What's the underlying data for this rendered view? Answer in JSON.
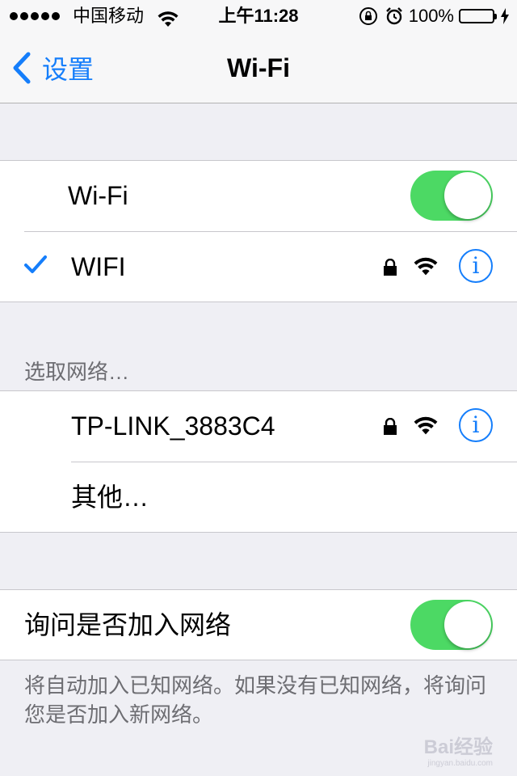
{
  "status_bar": {
    "carrier": "中国移动",
    "time": "上午11:28",
    "battery_pct": "100%",
    "battery_level": 1.0
  },
  "nav": {
    "back_label": "设置",
    "title": "Wi-Fi"
  },
  "wifi_toggle": {
    "label": "Wi-Fi",
    "on": true
  },
  "connected_network": {
    "name": "WIFI",
    "secured": true,
    "info_glyph": "i"
  },
  "choose_network_header": "选取网络…",
  "networks": [
    {
      "name": "TP-LINK_3883C4",
      "secured": true,
      "info_glyph": "i"
    }
  ],
  "other_label": "其他…",
  "ask_to_join": {
    "label": "询问是否加入网络",
    "on": true
  },
  "footer": "将自动加入已知网络。如果没有已知网络，将询问您是否加入新网络。",
  "watermark": {
    "brand": "Bai经验",
    "url": "jingyan.baidu.com"
  },
  "colors": {
    "accent": "#157efb",
    "toggle_on": "#4cd964",
    "background": "#efeff4"
  },
  "icons": [
    "signal-dots-icon",
    "wifi-icon",
    "rotation-lock-icon",
    "alarm-icon",
    "battery-icon",
    "charging-icon",
    "chevron-left-icon",
    "checkmark-icon",
    "lock-icon",
    "info-icon"
  ]
}
